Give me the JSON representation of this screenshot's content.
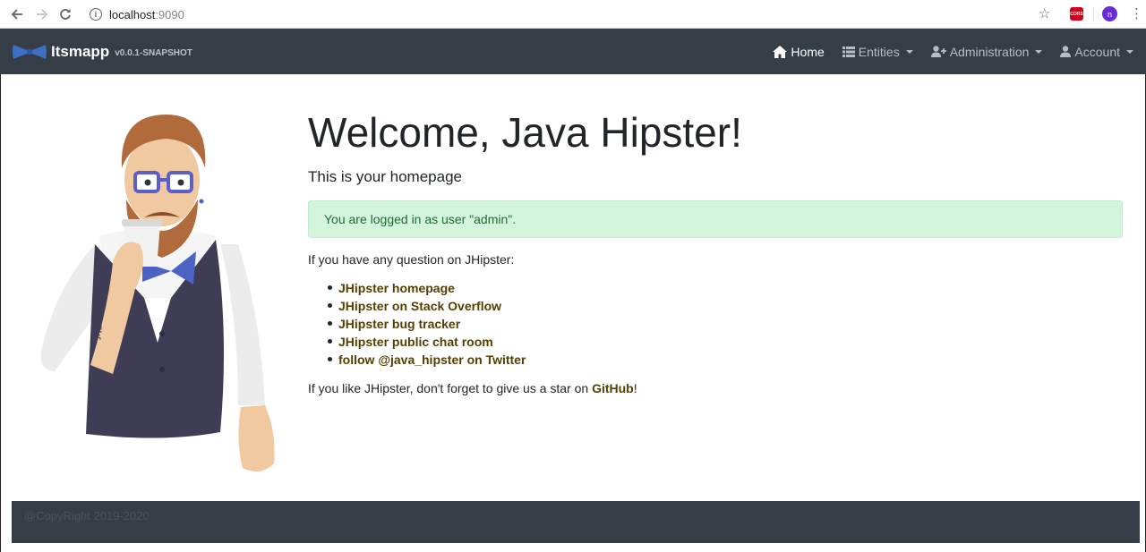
{
  "browser": {
    "url_host": "localhost",
    "url_port": ":9090",
    "extension_label": "CORS",
    "profile_initial": "n"
  },
  "navbar": {
    "brand": "Itsmapp",
    "version": "v0.0.1-SNAPSHOT",
    "items": [
      {
        "label": "Home",
        "icon": "home-icon",
        "active": true
      },
      {
        "label": "Entities",
        "icon": "list-icon",
        "dropdown": true
      },
      {
        "label": "Administration",
        "icon": "user-plus-icon",
        "dropdown": true
      },
      {
        "label": "Account",
        "icon": "user-icon",
        "dropdown": true
      }
    ]
  },
  "main": {
    "title": "Welcome, Java Hipster!",
    "subtitle": "This is your homepage",
    "alert": "You are logged in as user \"admin\".",
    "question": "If you have any question on JHipster:",
    "links": [
      "JHipster homepage",
      "JHipster on Stack Overflow",
      "JHipster bug tracker",
      "JHipster public chat room",
      "follow @java_hipster on Twitter"
    ],
    "star_prefix": "If you like JHipster, don't forget to give us a star on ",
    "star_link": "GitHub",
    "star_suffix": "!"
  },
  "footer": {
    "text": "@CopyRight 2019-2020"
  },
  "colors": {
    "navbar": "#353d47",
    "link": "#533f03",
    "alert_bg": "#d4f5dd"
  }
}
